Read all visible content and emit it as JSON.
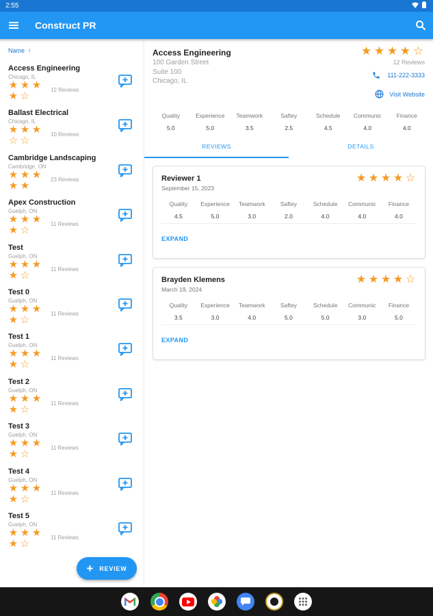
{
  "status_bar": {
    "time": "2:55"
  },
  "app": {
    "title": "Construct PR"
  },
  "sidebar": {
    "sort_label": "Name",
    "sort_arrow": "↑",
    "companies": [
      {
        "name": "Access Engineering",
        "location": "Chicago, IL",
        "reviews": "12 Reviews",
        "rating": 4
      },
      {
        "name": "Ballast Electrical",
        "location": "Chicago, IL",
        "reviews": "10 Reviews",
        "rating": 3
      },
      {
        "name": "Cambridge Landscaping",
        "location": "Cambridge, ON",
        "reviews": "23 Reviews",
        "rating": 5
      },
      {
        "name": "Apex Construction",
        "location": "Guelph, ON",
        "reviews": "11 Reviews",
        "rating": 4
      },
      {
        "name": "Test",
        "location": "Guelph, ON",
        "reviews": "11 Reviews",
        "rating": 4
      },
      {
        "name": "Test 0",
        "location": "Guelph, ON",
        "reviews": "11 Reviews",
        "rating": 4
      },
      {
        "name": "Test 1",
        "location": "Guelph, ON",
        "reviews": "11 Reviews",
        "rating": 4
      },
      {
        "name": "Test 2",
        "location": "Guelph, ON",
        "reviews": "11 Reviews",
        "rating": 4
      },
      {
        "name": "Test 3",
        "location": "Guelph, ON",
        "reviews": "11 Reviews",
        "rating": 4
      },
      {
        "name": "Test 4",
        "location": "Guelph, ON",
        "reviews": "11 Reviews",
        "rating": 4
      },
      {
        "name": "Test 5",
        "location": "Guelph, ON",
        "reviews": "11 Reviews",
        "rating": 4
      }
    ]
  },
  "fab": {
    "label": "REVIEW"
  },
  "detail": {
    "name": "Access Engineering",
    "address": [
      "100 Garden Street",
      "Suite 100",
      "Chicago, IL"
    ],
    "rating": 4,
    "reviews": "12 Reviews",
    "phone": "111-222-3333",
    "website": "Visit Website",
    "metrics": [
      {
        "label": "Quality",
        "value": "5.0"
      },
      {
        "label": "Experience",
        "value": "5.0"
      },
      {
        "label": "Teamwork",
        "value": "3.5"
      },
      {
        "label": "Saftey",
        "value": "2.5"
      },
      {
        "label": "Schedule",
        "value": "4.5"
      },
      {
        "label": "Communic",
        "value": "4.0"
      },
      {
        "label": "Finance",
        "value": "4.0"
      }
    ],
    "tabs": [
      "REVIEWS",
      "DETAILS"
    ],
    "active_tab": 0
  },
  "reviews": [
    {
      "name": "Reviewer 1",
      "date": "September 15, 2023",
      "rating": 4,
      "expand": "EXPAND",
      "metrics": [
        {
          "label": "Quality",
          "value": "4.5"
        },
        {
          "label": "Experience",
          "value": "5.0"
        },
        {
          "label": "Teamwork",
          "value": "3.0"
        },
        {
          "label": "Saftey",
          "value": "2.0"
        },
        {
          "label": "Schedule",
          "value": "4.0"
        },
        {
          "label": "Communic",
          "value": "4.0"
        },
        {
          "label": "Finance",
          "value": "4.0"
        }
      ]
    },
    {
      "name": "Brayden Klemens",
      "date": "March 19, 2024",
      "rating": 4,
      "expand": "EXPAND",
      "metrics": [
        {
          "label": "Quality",
          "value": "3.5"
        },
        {
          "label": "Experience",
          "value": "3.0"
        },
        {
          "label": "Teamwork",
          "value": "4.0"
        },
        {
          "label": "Saftey",
          "value": "5.0"
        },
        {
          "label": "Schedule",
          "value": "5.0"
        },
        {
          "label": "Communic",
          "value": "3.0"
        },
        {
          "label": "Finance",
          "value": "5.0"
        }
      ]
    }
  ],
  "dock": {
    "apps": [
      "gmail-icon",
      "chrome-icon",
      "youtube-icon",
      "photos-icon",
      "messages-icon",
      "app-icon",
      "app-drawer-icon"
    ]
  },
  "colors": {
    "primary": "#2196f3",
    "primary_dark": "#1976d2",
    "star": "#f59a23"
  }
}
